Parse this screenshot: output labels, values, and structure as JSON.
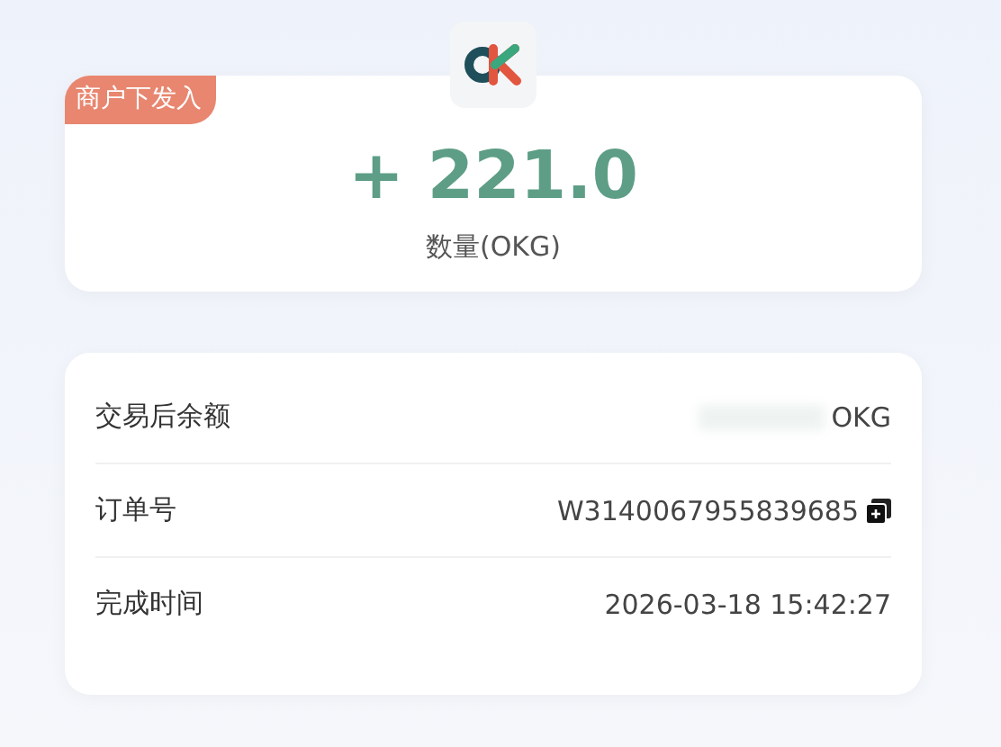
{
  "summary": {
    "badge": "商户下发入",
    "amount": "+ 221.0",
    "amount_label": "数量(OKG)"
  },
  "details": [
    {
      "kind": "redacted",
      "label": "交易后余额",
      "value": "OKG"
    },
    {
      "kind": "copy",
      "label": "订单号",
      "value": "W3140067955839685"
    },
    {
      "kind": "plain",
      "label": "完成时间",
      "value": "2026-03-18 15:42:27"
    }
  ]
}
